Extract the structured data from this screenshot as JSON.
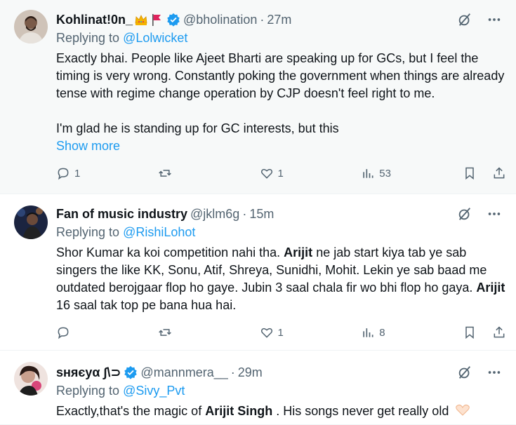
{
  "tweets": [
    {
      "name": "Kohlinat!0n_",
      "emojis": [
        "crown",
        "red-flag"
      ],
      "verified": true,
      "handle": "@bholination",
      "time": "27m",
      "replying_prefix": "Replying to",
      "replying_to": "@Lolwicket",
      "paragraphs": [
        "Exactly bhai. People like Ajeet Bharti are speaking up for GCs, but I feel the timing is very wrong. Constantly poking the government when things are already tense with regime change operation by CJP doesn't feel right to me.",
        "I'm glad he is standing up for GC interests, but this"
      ],
      "show_more": "Show more",
      "replies": "1",
      "retweets": "",
      "likes": "1",
      "views": "53",
      "avatar_color": "#7a5a48"
    },
    {
      "name": "Fan of music industry",
      "verified": false,
      "handle": "@jklm6g",
      "time": "15m",
      "replying_prefix": "Replying to",
      "replying_to": "@RishiLohot",
      "text_segments": [
        {
          "t": "Shor Kumar ka koi competition nahi tha. ",
          "b": false
        },
        {
          "t": "Arijit",
          "b": true
        },
        {
          "t": " ne jab start kiya tab ye sab singers the like KK, Sonu, Atif, Shreya, Sunidhi, Mohit. Lekin ye sab baad me outdated berojgaar flop ho gaye. Jubin 3 saal chala fir wo bhi flop ho gaya. ",
          "b": false
        },
        {
          "t": "Arijit",
          "b": true
        },
        {
          "t": " 16 saal tak top pe bana hua hai.",
          "b": false
        }
      ],
      "replies": "",
      "retweets": "",
      "likes": "1",
      "views": "8",
      "avatar_color": "#2c3e66"
    },
    {
      "name": "ѕняєуα ∫\\⊃",
      "verified": true,
      "handle": "@mannmera__",
      "time": "29m",
      "replying_prefix": "Replying to",
      "replying_to": "@Sivy_Pvt",
      "text_segments": [
        {
          "t": "Exactly,that's the magic of ",
          "b": false
        },
        {
          "t": "Arijit Singh",
          "b": true
        },
        {
          "t": " . His songs never get really old",
          "b": false
        }
      ],
      "trailing_icon": "heart-hands-emoji",
      "avatar_color": "#b88a8a"
    }
  ],
  "colors": {
    "accent": "#1d9bf0",
    "muted": "#536471",
    "text": "#0f1419",
    "hover_bg": "#f7f9f9"
  }
}
